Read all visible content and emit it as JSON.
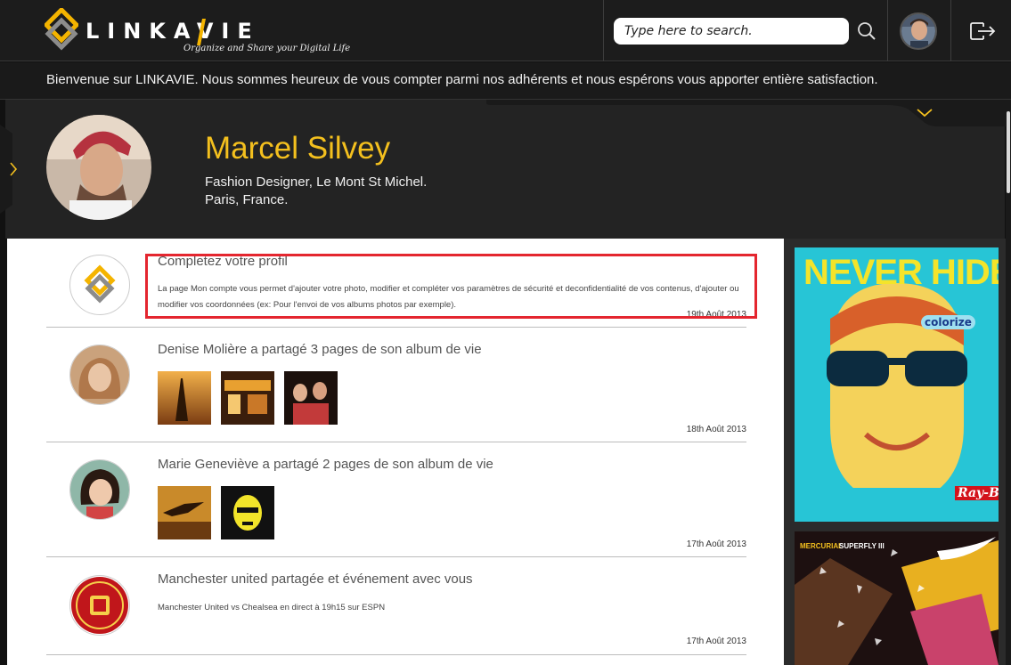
{
  "header": {
    "logo_word": "LINKAVIE",
    "logo_tagline": "Organize and Share your Digital Life",
    "search_placeholder": "Type here to search.",
    "icons": [
      "logo-mark",
      "search-icon",
      "user-avatar",
      "logout-icon"
    ]
  },
  "welcome": {
    "text": "Bienvenue sur LINKAVIE. Nous sommes heureux de vous compter parmi nos adhérents et nous espérons vous apporter entière satisfaction."
  },
  "profile": {
    "name": "Marcel Silvey",
    "line1": "Fashion Designer, Le Mont St Michel.",
    "line2": "Paris, France."
  },
  "feed": {
    "items": [
      {
        "title": "Completez votre profil",
        "body": "La page Mon compte  vous permet d'ajouter votre photo, modifier et compléter vos paramètres de sécurité et deconfidentialité de vos contenus, d'ajouter ou modifier vos coordonnées (ex: Pour l'envoi de vos albums photos par exemple).",
        "date": "19th Août 2013"
      },
      {
        "title": "Denise Molière a partagé 3 pages de son album de vie",
        "date": "18th Août 2013"
      },
      {
        "title": "Marie Geneviève a partagé 2 pages de son album de vie",
        "date": "17th Août 2013"
      },
      {
        "title": "Manchester united partagée et événement avec vous",
        "body": "Manchester United vs Chealsea en direct à 19h15 sur ESPN",
        "date": "17th Août 2013"
      }
    ]
  },
  "ads": {
    "ad1_headline": "NEVER HIDE",
    "ad1_brand": "Ray-Ban",
    "ad1_badge": "colorize",
    "ad2_label_a": "MERCURIAL",
    "ad2_label_b": "SUPERFLY III"
  },
  "colors": {
    "accent_yellow": "#f4c01e",
    "highlight_red": "#e4262f",
    "topbar_bg": "#1c1c1c"
  }
}
